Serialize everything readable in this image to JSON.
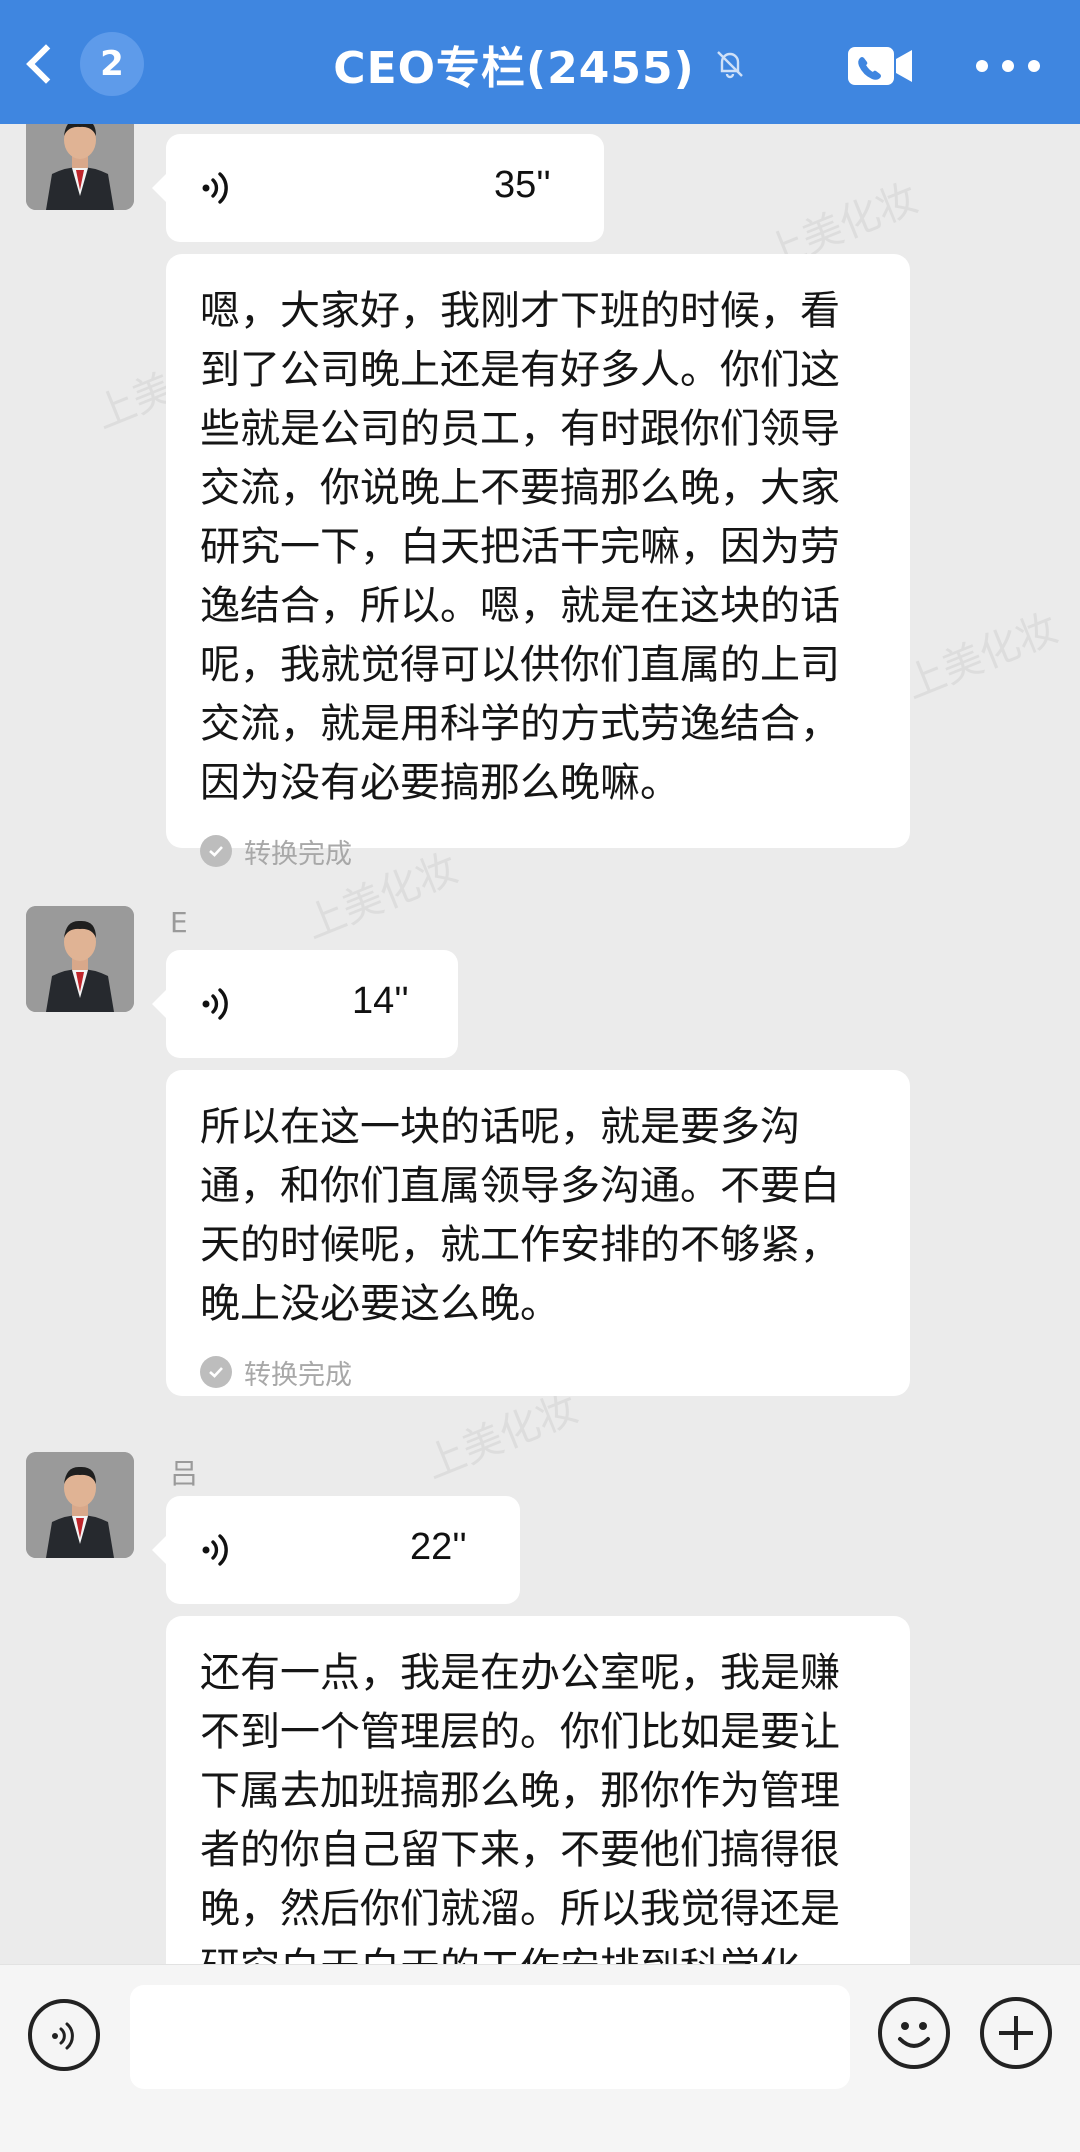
{
  "header": {
    "title": "CEO专栏(2455)",
    "unread_count": "2",
    "background_color": "#3f86e0",
    "icons": [
      "back-chevron-icon",
      "mute-bell-icon",
      "video-call-icon",
      "more-icon"
    ]
  },
  "watermark": {
    "text": "上美化妆"
  },
  "messages": [
    {
      "sender": "",
      "voice_duration": "35''",
      "transcript": "嗯，大家好，我刚才下班的时候，看\n到了公司晚上还是有好多人。你们这\n些就是公司的员工，有时跟你们领导\n交流，你说晚上不要搞那么晚，大家\n研究一下，白天把活干完嘛，因为劳\n逸结合，所以。嗯，就是在这块的话\n呢，我就觉得可以供你们直属的上司\n交流，就是用科学的方式劳逸结合，\n因为没有必要搞那么晚嘛。",
      "status": "转换完成"
    },
    {
      "sender": "E",
      "voice_duration": "14''",
      "transcript": "所以在这一块的话呢，就是要多沟\n通，和你们直属领导多沟通。不要白\n天的时候呢，就工作安排的不够紧，\n晚上没必要这么晚。",
      "status": "转换完成"
    },
    {
      "sender": "吕",
      "voice_duration": "22''",
      "transcript": "还有一点，我是在办公室呢，我是赚\n不到一个管理层的。你们比如是要让\n下属去加班搞那么晚，那你作为管理\n者的你自己留下来，不要他们搞得很\n晚，然后你们就溜。所以我觉得还是\n研究白天白天的工作安排到科学化。",
      "status": ""
    }
  ],
  "input_bar": {
    "placeholder": "",
    "icons": [
      "voice-toggle-icon",
      "emoji-icon",
      "plus-icon"
    ]
  }
}
